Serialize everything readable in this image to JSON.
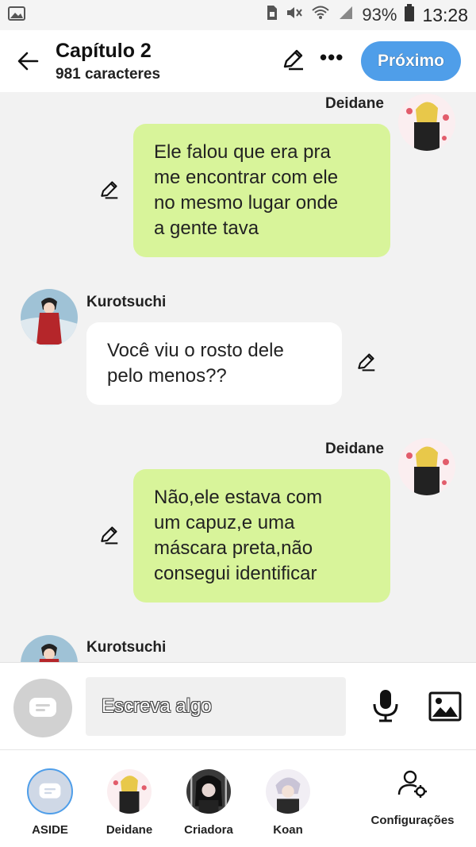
{
  "status_bar": {
    "battery": "93%",
    "time": "13:28"
  },
  "header": {
    "title": "Capítulo 2",
    "subtitle": "981 caracteres",
    "next_label": "Próximo"
  },
  "messages": [
    {
      "sender": "Deidane",
      "side": "right",
      "text": "Ele falou que era pra\nme encontrar com ele\nno mesmo lugar onde\na gente tava"
    },
    {
      "sender": "Kurotsuchi",
      "side": "left",
      "text": "Você viu o rosto dele\npelo menos??"
    },
    {
      "sender": "Deidane",
      "side": "right",
      "text": "Não,ele estava com\num capuz,e uma\nmáscara preta,não\nconsegui identificar"
    },
    {
      "sender": "Kurotsuchi",
      "side": "left",
      "text": ""
    }
  ],
  "composer": {
    "placeholder": "Escreva algo"
  },
  "tabs": [
    {
      "label": "ASIDE"
    },
    {
      "label": "Deidane"
    },
    {
      "label": "Criadora"
    },
    {
      "label": "Koan"
    },
    {
      "label": "Configurações"
    }
  ],
  "colors": {
    "accent": "#4f9ee9",
    "bubble_green": "#d8f49a",
    "bubble_white": "#ffffff",
    "background": "#f2f2f2"
  }
}
